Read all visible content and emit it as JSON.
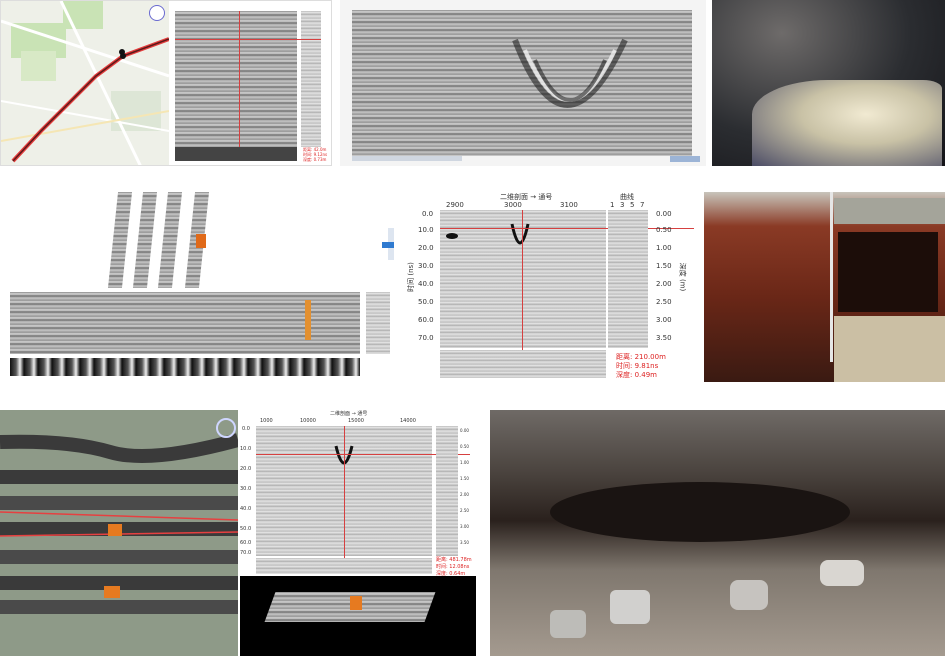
{
  "colors": {
    "radar_red": "#d64040",
    "map_bg": "#eef0e8",
    "map_green": "#c9e3b5",
    "route_red": "#e43c3c",
    "photo_dark": "#2b2d31",
    "soil": "#8a3a25"
  },
  "icons": {
    "compass": "compass-icon",
    "map_pin": "map-pin-icon",
    "tools": "toolbar-icons"
  },
  "panel_a": {
    "readouts": {
      "distance": "距离: 42.0m",
      "time": "时间: 9.12ns",
      "depth": "深度: 0.73m"
    }
  },
  "panel_e": {
    "title": "二维剖面 → 通号",
    "x_ticks": [
      "2900",
      "3000",
      "3100"
    ],
    "y_ticks": [
      "0.0",
      "10.0",
      "20.0",
      "30.0",
      "40.0",
      "50.0",
      "60.0",
      "70.0"
    ],
    "y_axis_label": "时间 (ns)",
    "side_title": "曲线",
    "side_ticks": [
      "0.00",
      "0.50",
      "1.00",
      "1.50",
      "2.00",
      "2.50",
      "3.00",
      "3.50"
    ],
    "side_axis_label": "深度 (m)",
    "side_top_ticks": [
      "1",
      "3",
      "5",
      "7"
    ],
    "readouts": {
      "distance": "距离: 210.00m",
      "time": "时间: 9.81ns",
      "depth": "深度: 0.49m"
    }
  },
  "panel_g": {
    "title": "二维剖面 → 通号",
    "x_ticks": [
      "1000",
      "10000",
      "15000",
      "14000"
    ],
    "y_ticks": [
      "0.0",
      "10.0",
      "20.0",
      "30.0",
      "40.0",
      "50.0",
      "60.0",
      "70.0"
    ],
    "side_ticks": [
      "0.00",
      "0.50",
      "1.00",
      "1.50",
      "2.00",
      "2.50",
      "3.00",
      "3.50"
    ],
    "readouts": {
      "distance": "距离: 481.78m",
      "time": "时间: 12.08ns",
      "depth": "深度: 0.64m"
    }
  }
}
